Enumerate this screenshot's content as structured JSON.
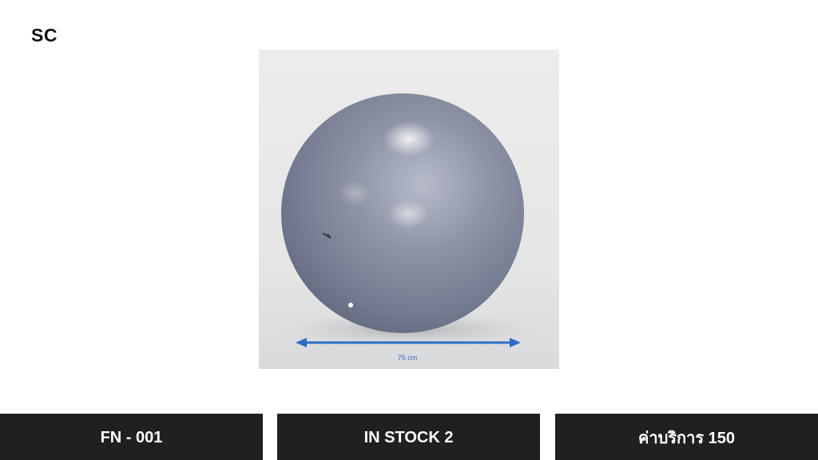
{
  "brand": {
    "logo_text": "SC"
  },
  "product": {
    "image": {
      "subject": "exercise-ball",
      "measurement_label": "75 cm",
      "colors": {
        "ball": "#8e93a6",
        "arrow": "#2f6bc9",
        "background": "#e6e7e7"
      }
    }
  },
  "info_bar": {
    "code": "FN - 001",
    "stock": "IN STOCK 2",
    "price": "ค่าบริการ 150"
  }
}
